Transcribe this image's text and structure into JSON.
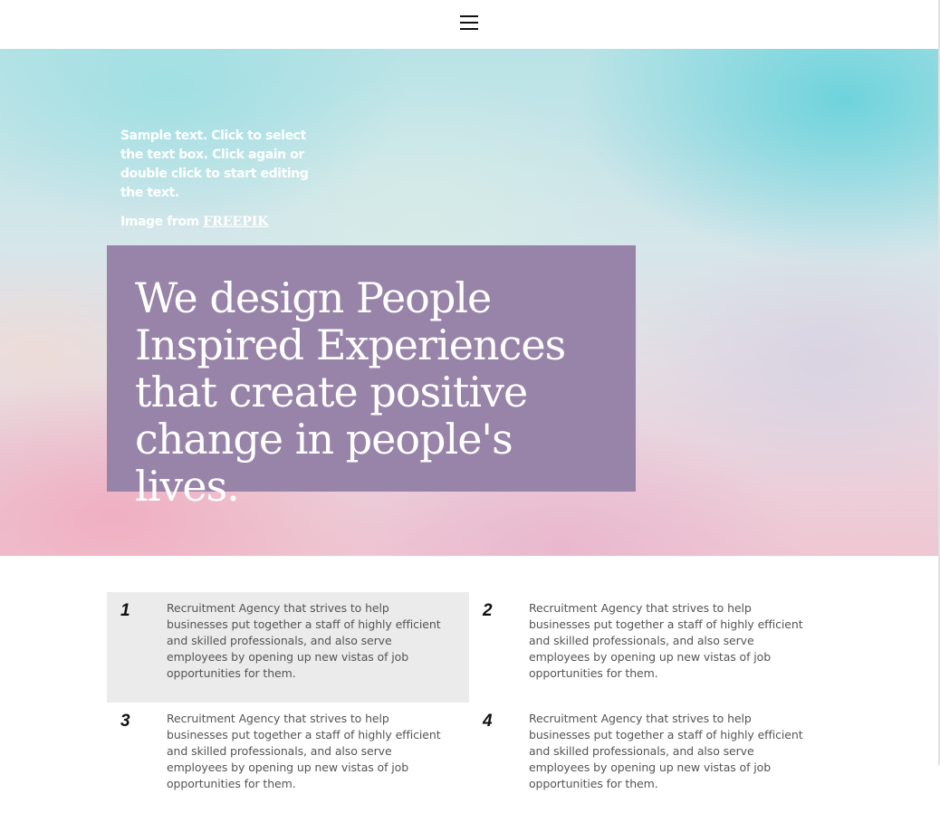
{
  "header": {
    "menu_icon": "hamburger-menu-icon"
  },
  "hero": {
    "sample_text": "Sample text. Click to select the text box. Click again or double click to start editing the text.",
    "credit_prefix": "Image from ",
    "credit_link": "FREEPIK",
    "heading": "We design People Inspired Experiences that create positive change in people's lives.",
    "box_color": "#9883a9"
  },
  "features": [
    {
      "number": "1",
      "text": "Recruitment Agency that strives to help businesses put together a staff of highly efficient and skilled professionals, and also serve employees by opening up new vistas of job opportunities for them."
    },
    {
      "number": "2",
      "text": "Recruitment Agency that strives to help businesses put together a staff of highly efficient and skilled professionals, and also serve employees by opening up new vistas of job opportunities for them."
    },
    {
      "number": "3",
      "text": "Recruitment Agency that strives to help businesses put together a staff of highly efficient and skilled professionals, and also serve employees by opening up new vistas of job opportunities for them."
    },
    {
      "number": "4",
      "text": "Recruitment Agency that strives to help businesses put together a staff of highly efficient and skilled professionals, and also serve employees by opening up new vistas of job opportunities for them."
    }
  ],
  "colors": {
    "feature_highlight": "#ebebeb",
    "feature_text": "#555555"
  }
}
